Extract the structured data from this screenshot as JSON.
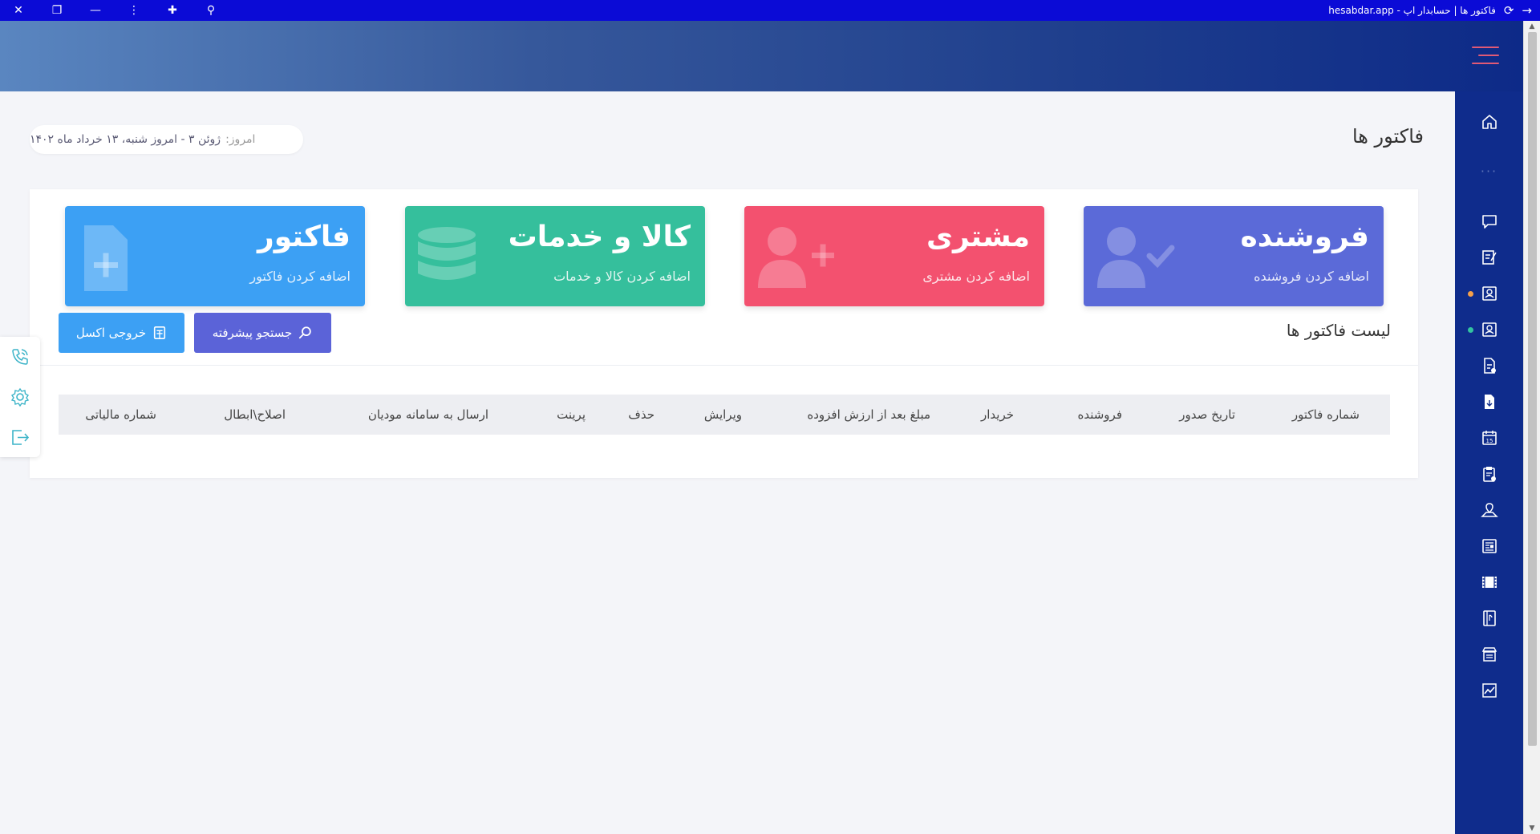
{
  "window": {
    "title": "فاکتور ها | حسابدار اپ - hesabdar.app",
    "controls": [
      "close-icon",
      "restore-icon",
      "minimize-icon",
      "menu-dots-icon",
      "extension-icon",
      "zoom-icon"
    ],
    "nav_icons": [
      "forward-arrow-icon",
      "reload-icon"
    ]
  },
  "header": {
    "gradient": [
      "#5a86c0",
      "#0d2a88"
    ],
    "hamburger_color": "#e05a76"
  },
  "page": {
    "title": "فاکتور ها",
    "date_label": "امروز:",
    "date_value": "ژوئن ۳ - امروز شنبه، ۱۳ خرداد ماه ۱۴۰۲"
  },
  "tiles": [
    {
      "title": "فروشنده",
      "subtitle": "اضافه کردن فروشنده",
      "color": "#5b6ad8",
      "icon": "user-check-icon"
    },
    {
      "title": "مشتری",
      "subtitle": "اضافه کردن مشتری",
      "color": "#f3516f",
      "icon": "user-plus-icon"
    },
    {
      "title": "کالا و خدمات",
      "subtitle": "اضافه کردن کالا و خدمات",
      "color": "#35bf9c",
      "icon": "database-icon"
    },
    {
      "title": "فاکتور",
      "subtitle": "اضافه کردن فاکتور",
      "color": "#3ca0f4",
      "icon": "file-plus-icon"
    }
  ],
  "list": {
    "title": "لیست فاکتور ها",
    "advanced_search": "جستجو پیشرفته",
    "excel_export": "خروجی اکسل",
    "columns": [
      "شماره فاکتور",
      "تاریخ صدور",
      "فروشنده",
      "خریدار",
      "مبلغ بعد از ارزش افزوده",
      "ویرایش",
      "حذف",
      "پرینت",
      "ارسال به سامانه مودیان",
      "اصلاح\\ابطال",
      "شماره مالیاتی"
    ]
  },
  "sidebar": {
    "items": [
      "home-icon",
      "chat-icon",
      "invoice-edit-icon",
      "ledger-icon",
      "ledger-icon",
      "document-add-icon",
      "document-icon",
      "calendar-icon",
      "clipboard-icon",
      "map-icon",
      "newspaper-icon",
      "film-icon",
      "book-icon",
      "store-icon",
      "chart-icon"
    ],
    "calendar_day": "15",
    "dot_colors": [
      "#f5a04a",
      "#33c4a0"
    ]
  },
  "floating_panel": {
    "items": [
      "phone-icon",
      "settings-icon",
      "logout-icon"
    ]
  },
  "colors": {
    "sidebar": "#0f2c8c",
    "titlebar": "#0b0bd6",
    "btn_search": "#5b63d8",
    "btn_excel": "#3ca0f4"
  }
}
